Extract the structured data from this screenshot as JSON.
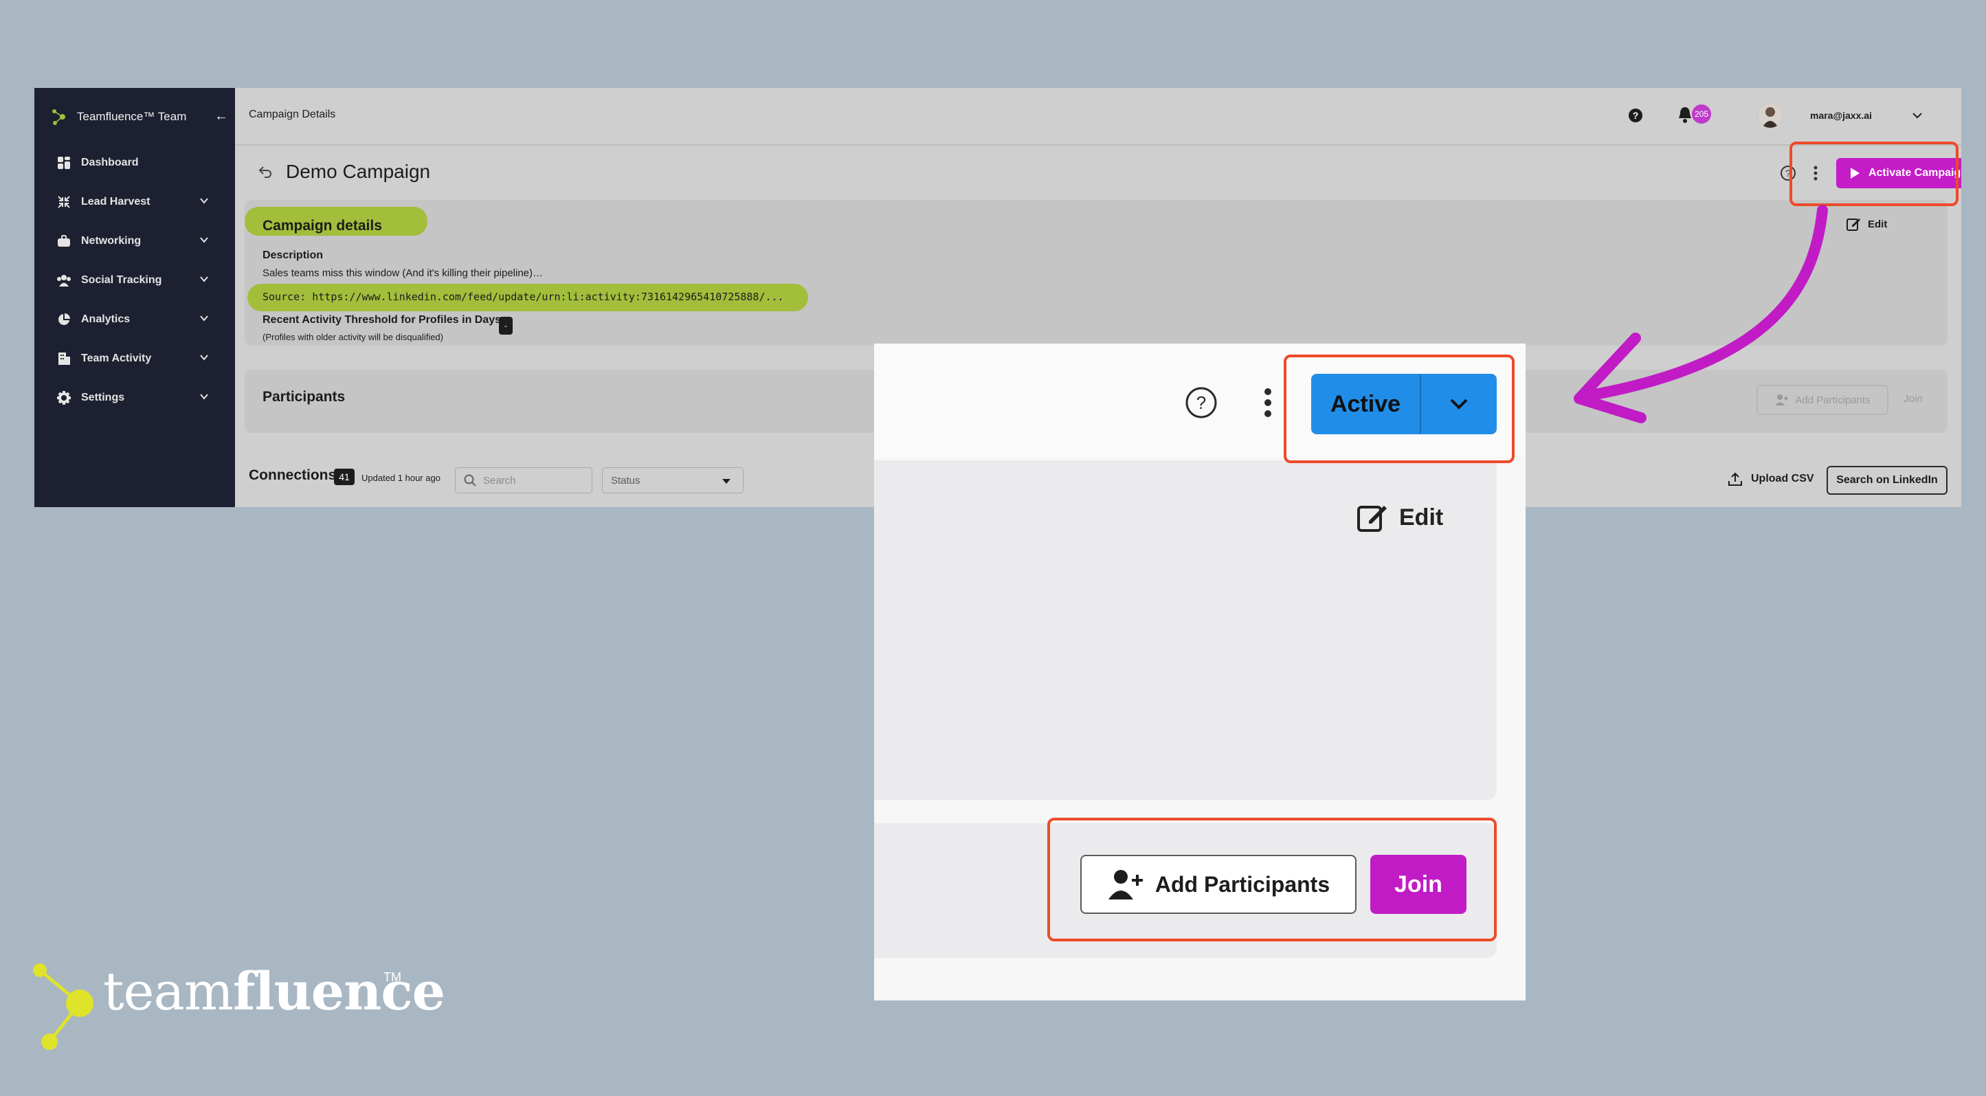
{
  "sidebar": {
    "brand": "Teamfluence™ Team",
    "items": [
      {
        "label": "Dashboard",
        "icon": "grid-icon"
      },
      {
        "label": "Lead Harvest",
        "icon": "compress-icon"
      },
      {
        "label": "Networking",
        "icon": "briefcase-icon"
      },
      {
        "label": "Social Tracking",
        "icon": "users-icon"
      },
      {
        "label": "Analytics",
        "icon": "pie-chart-icon"
      },
      {
        "label": "Team Activity",
        "icon": "building-icon"
      },
      {
        "label": "Settings",
        "icon": "gear-icon"
      }
    ]
  },
  "topbar": {
    "breadcrumb": "Campaign Details",
    "notifications": "205",
    "user_email": "mara@jaxx.ai"
  },
  "campaign": {
    "title": "Demo Campaign",
    "activate_label": "Activate Campaign"
  },
  "details": {
    "title": "Campaign details",
    "edit_label": "Edit",
    "description_label": "Description",
    "description_text": "Sales teams miss this window (And it's killing their pipeline)…",
    "source_line": "Source: https://www.linkedin.com/feed/update/urn:li:activity:7316142965410725888/...",
    "threshold_label": "Recent Activity Threshold for Profiles in Days",
    "threshold_note": "(Profiles with older activity will be disqualified)",
    "threshold_value": "-"
  },
  "participants": {
    "title": "Participants",
    "add_label": "Add Participants",
    "join_label": "Join"
  },
  "connections": {
    "title": "Connections",
    "count": "41",
    "updated": "Updated 1 hour ago",
    "search_placeholder": "Search",
    "status_label": "Status",
    "upload_label": "Upload CSV",
    "linkedin_label": "Search on LinkedIn"
  },
  "zoom": {
    "active_label": "Active",
    "edit_label": "Edit",
    "add_label": "Add Participants",
    "join_label": "Join"
  },
  "footer": {
    "brand_light": "team",
    "brand_bold": "fluence",
    "tm": "TM"
  },
  "colors": {
    "accent_magenta": "#c41dc8",
    "highlight_red": "#ee4a2a",
    "highlight_green": "#a3be3b",
    "active_blue": "#208ee9",
    "sidebar_bg": "#1d2030",
    "background": "#a9b7c3"
  }
}
